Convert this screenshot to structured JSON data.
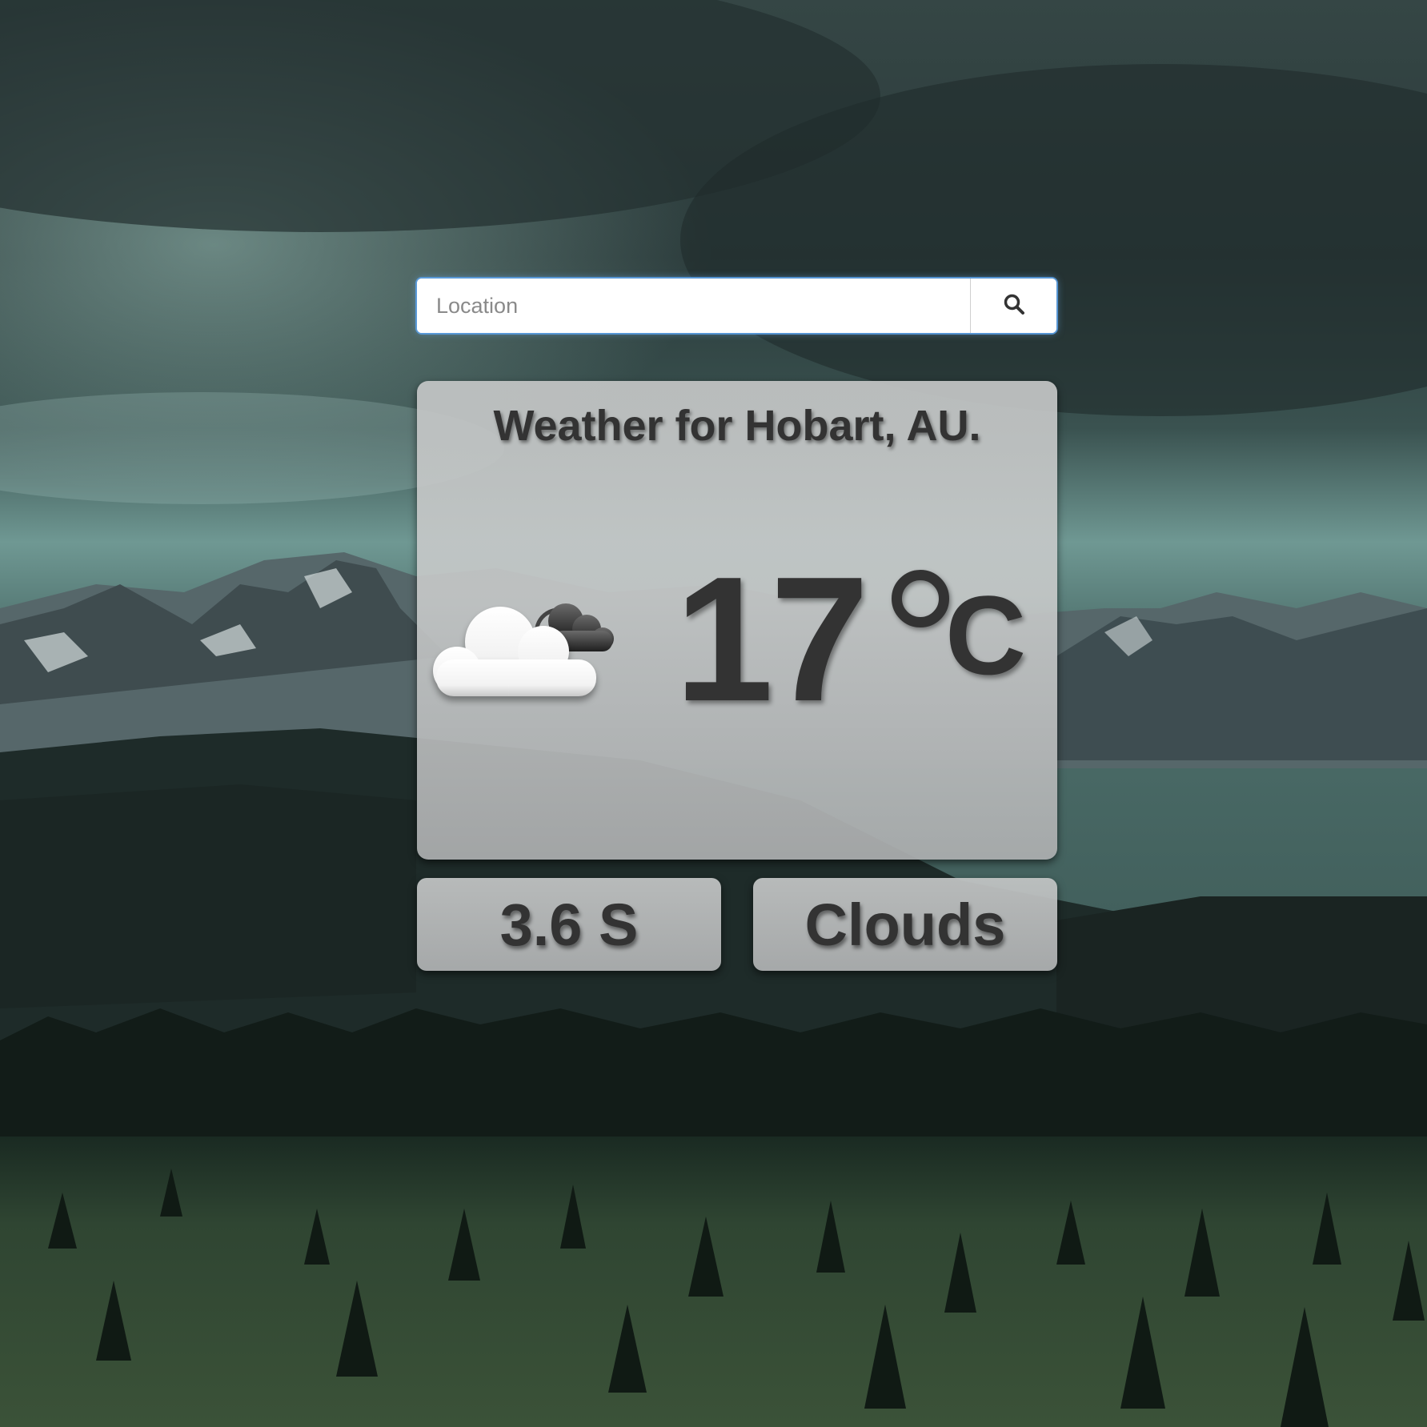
{
  "search": {
    "placeholder": "Location",
    "value": "",
    "button_icon": "search-icon"
  },
  "weather": {
    "title": "Weather for Hobart, AU.",
    "icon": "partly-cloudy-icon",
    "temperature": "17",
    "degree_symbol": "°",
    "unit": "C",
    "wind": "3.6 S",
    "condition": "Clouds"
  },
  "colors": {
    "text": "#333333",
    "card": "#c3c5c5",
    "focus_ring": "#5aa0e6"
  }
}
